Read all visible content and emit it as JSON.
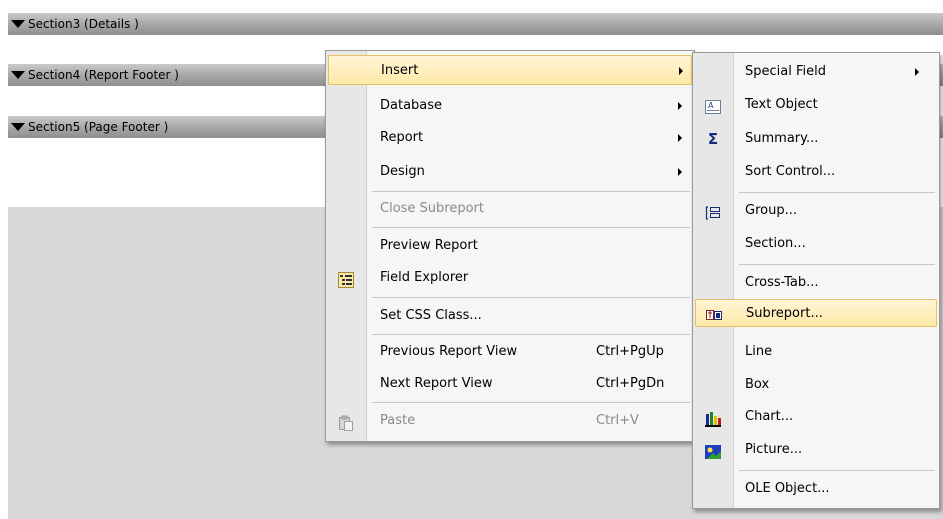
{
  "sections": [
    {
      "label": "Section3 (Details  )"
    },
    {
      "label": "Section4 (Report Footer  )"
    },
    {
      "label": "Section5 (Page Footer  )"
    }
  ],
  "context_menu": {
    "items": [
      {
        "label": "Insert",
        "submenu": true,
        "highlighted": true
      },
      {
        "label": "Database",
        "submenu": true
      },
      {
        "label": "Report",
        "submenu": true
      },
      {
        "label": "Design",
        "submenu": true
      },
      {
        "label": "Close Subreport",
        "disabled": true
      },
      {
        "label": "Preview Report"
      },
      {
        "label": "Field Explorer",
        "icon": "field-explorer-icon"
      },
      {
        "label": "Set CSS Class..."
      },
      {
        "label": "Previous Report View",
        "shortcut": "Ctrl+PgUp"
      },
      {
        "label": "Next Report View",
        "shortcut": "Ctrl+PgDn"
      },
      {
        "label": "Paste",
        "shortcut": "Ctrl+V",
        "disabled": true,
        "icon": "paste-icon"
      }
    ]
  },
  "insert_submenu": {
    "items": [
      {
        "label": "Special Field",
        "submenu": true
      },
      {
        "label": "Text Object",
        "icon": "text-object-icon"
      },
      {
        "label": "Summary...",
        "icon": "sigma-icon"
      },
      {
        "label": "Sort Control..."
      },
      {
        "label": "Group...",
        "icon": "group-icon"
      },
      {
        "label": "Section..."
      },
      {
        "label": "Cross-Tab..."
      },
      {
        "label": "Subreport...",
        "icon": "subreport-icon",
        "highlighted": true
      },
      {
        "label": "Line"
      },
      {
        "label": "Box"
      },
      {
        "label": "Chart...",
        "icon": "chart-icon"
      },
      {
        "label": "Picture...",
        "icon": "picture-icon"
      },
      {
        "label": "OLE Object..."
      }
    ]
  }
}
